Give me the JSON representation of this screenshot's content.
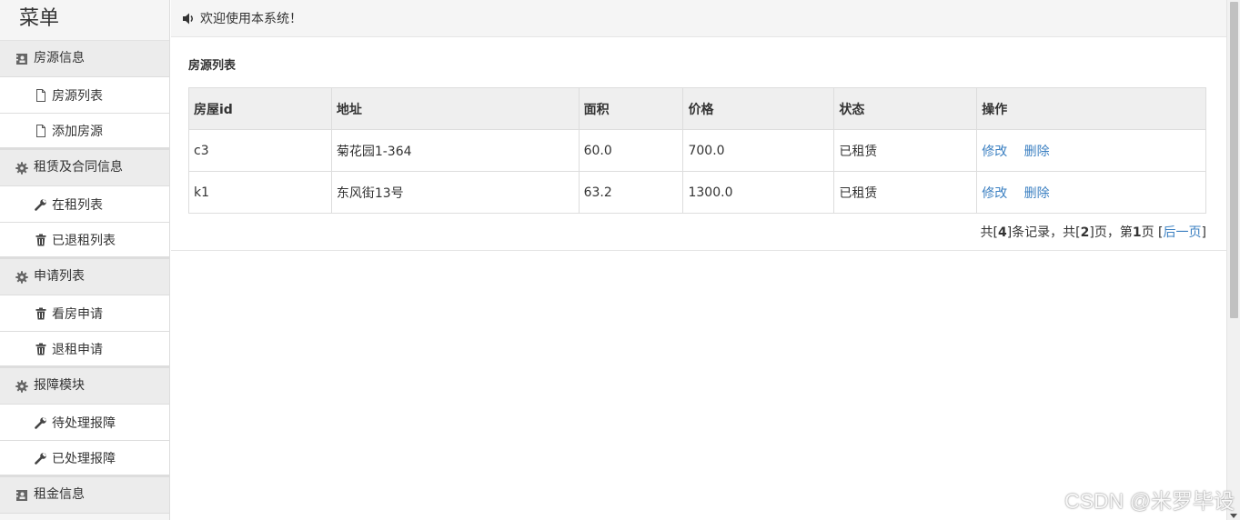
{
  "sidebar": {
    "title": "菜单",
    "groups": [
      {
        "label": "房源信息",
        "items": [
          {
            "label": "房源列表"
          },
          {
            "label": "添加房源"
          }
        ]
      },
      {
        "label": "租赁及合同信息",
        "items": [
          {
            "label": "在租列表"
          },
          {
            "label": "已退租列表"
          }
        ]
      },
      {
        "label": "申请列表",
        "items": [
          {
            "label": "看房申请"
          },
          {
            "label": "退租申请"
          }
        ]
      },
      {
        "label": "报障模块",
        "items": [
          {
            "label": "待处理报障"
          },
          {
            "label": "已处理报障"
          }
        ]
      },
      {
        "label": "租金信息"
      }
    ]
  },
  "topbar": {
    "welcome": "欢迎使用本系统！"
  },
  "panel": {
    "title": "房源列表",
    "columns": [
      "房屋id",
      "地址",
      "面积",
      "价格",
      "状态",
      "操作"
    ],
    "rows": [
      {
        "id": "c3",
        "address": "菊花园1-364",
        "area": "60.0",
        "price": "700.0",
        "status": "已租赁",
        "edit": "修改",
        "delete": "删除"
      },
      {
        "id": "k1",
        "address": "东风街13号",
        "area": "63.2",
        "price": "1300.0",
        "status": "已租赁",
        "edit": "修改",
        "delete": "删除"
      }
    ],
    "pager": {
      "prefix": "共[",
      "total": "4",
      "mid1": "]条记录，共[",
      "pages": "2",
      "mid2": "]页，第",
      "current": "1",
      "mid3": "页 [",
      "next": "后一页",
      "suffix": "]"
    }
  },
  "watermark": "CSDN @米罗毕设"
}
